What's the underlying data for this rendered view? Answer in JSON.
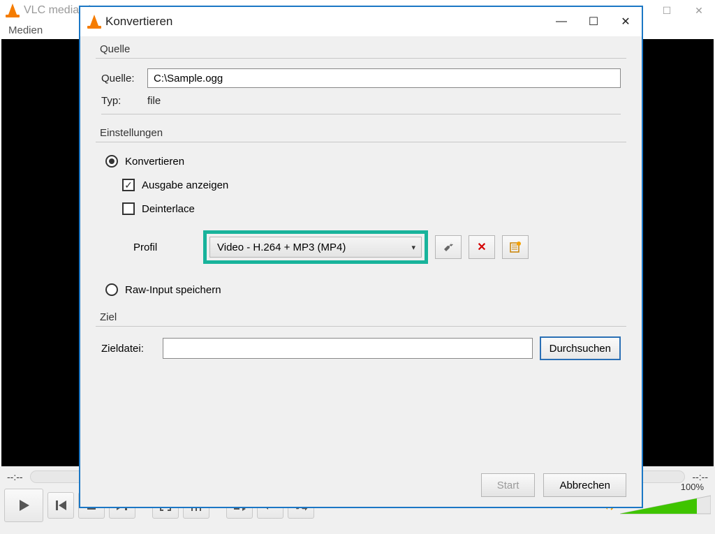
{
  "main": {
    "title": "VLC media player",
    "menu_medien": "Medien",
    "time_left": "--:--",
    "time_right": "--:--",
    "volume_pct": "100%"
  },
  "dialog": {
    "title": "Konvertieren",
    "quelle_group": "Quelle",
    "quelle_label": "Quelle:",
    "quelle_value": "C:\\Sample.ogg",
    "typ_label": "Typ:",
    "typ_value": "file",
    "einstellungen_group": "Einstellungen",
    "radio_konvertieren": "Konvertieren",
    "check_ausgabe": "Ausgabe anzeigen",
    "check_deinterlace": "Deinterlace",
    "profil_label": "Profil",
    "profil_value": "Video - H.264 + MP3 (MP4)",
    "radio_raw": "Raw-Input speichern",
    "ziel_group": "Ziel",
    "zieldatei_label": "Zieldatei:",
    "zieldatei_value": "",
    "durchsuchen": "Durchsuchen",
    "start": "Start",
    "abbrechen": "Abbrechen"
  }
}
